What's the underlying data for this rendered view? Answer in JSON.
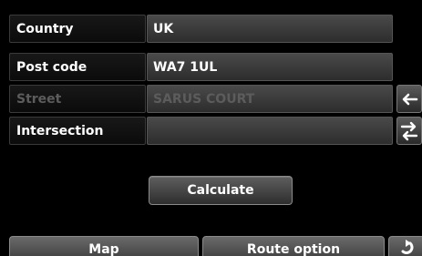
{
  "form": {
    "country_label": "Country",
    "country_value": "UK",
    "postcode_label": "Post code",
    "postcode_value": "WA7 1UL",
    "street_label": "Street",
    "street_value": "SARUS COURT",
    "intersection_label": "Intersection",
    "intersection_value": ""
  },
  "buttons": {
    "calculate_label": "Calculate",
    "map_label": "Map",
    "route_option_label": "Route option"
  },
  "icons": {
    "street_side": "arrow-left-icon",
    "intersection_side": "swap-arrows-icon",
    "back": "back-arrow-icon"
  },
  "colors": {
    "background": "#000000",
    "field_fill": "#3a3a3a",
    "disabled_text": "#5c5c5c"
  }
}
